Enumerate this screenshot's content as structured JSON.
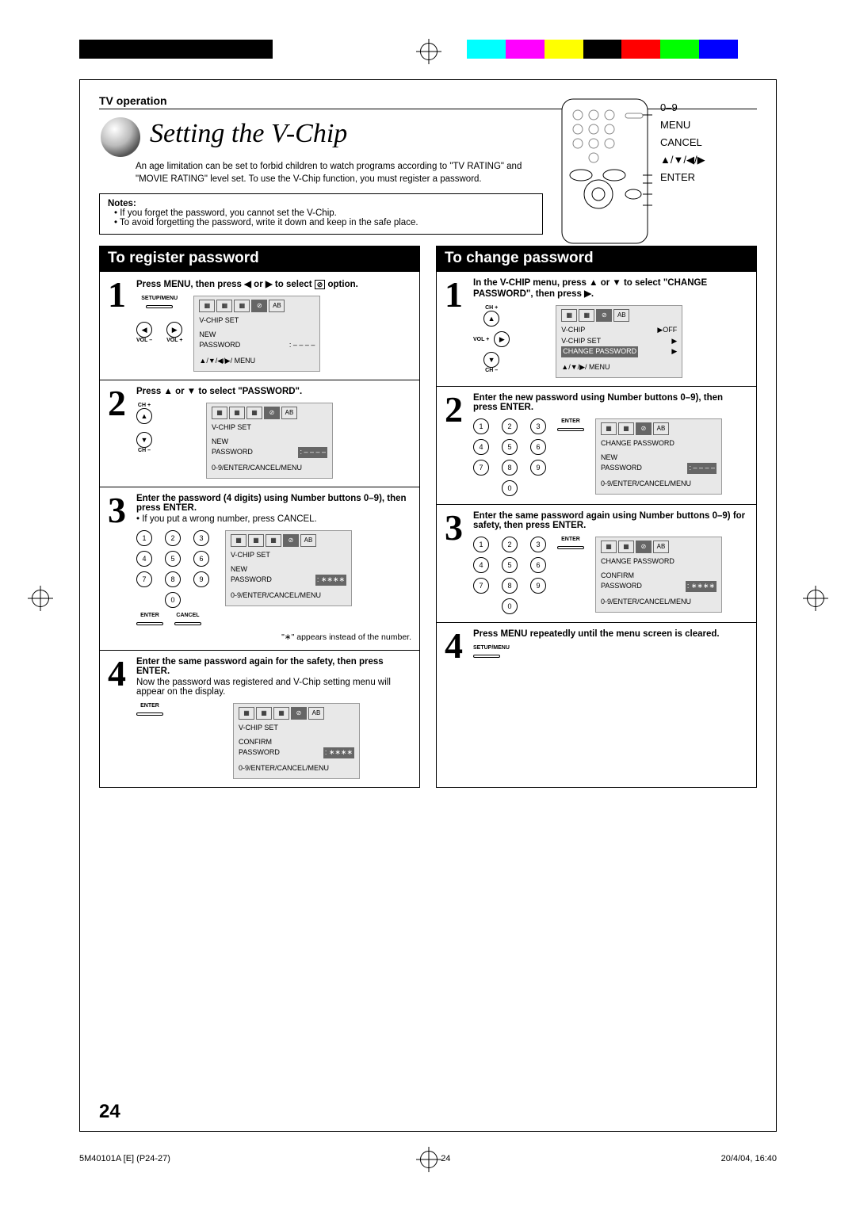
{
  "header": {
    "section": "TV operation"
  },
  "title": "Setting the V-Chip",
  "intro": "An age limitation can be set to forbid children to watch programs according to \"TV RATING\" and \"MOVIE RATING\" level set. To use the V-Chip function, you must register a password.",
  "notes": {
    "heading": "Notes:",
    "items": [
      "If you forget the password, you cannot set the V-Chip.",
      "To avoid forgetting the password, write it down and keep in the safe place."
    ]
  },
  "remote_labels": {
    "l1": "0–9",
    "l2": "MENU",
    "l3": "CANCEL",
    "l4": "▲/▼/◀/▶",
    "l5": "ENTER"
  },
  "left": {
    "heading": "To register password",
    "s1": {
      "text_a": "Press MENU, then press ◀ or ▶ to select ",
      "text_b": " option.",
      "btn_menu": "SETUP/MENU",
      "btn_voln": "VOL –",
      "btn_volp": "VOL +",
      "osd": {
        "title": "V-CHIP SET",
        "r1a": "NEW",
        "r1b": "",
        "r2a": "PASSWORD",
        "r2b": ": – – – –",
        "foot": "▲/▼/◀/▶/ MENU"
      }
    },
    "s2": {
      "text": "Press ▲ or ▼ to select \"PASSWORD\".",
      "btn_chp": "CH +",
      "btn_chn": "CH –",
      "osd": {
        "title": "V-CHIP SET",
        "r1a": "NEW",
        "r2a": "PASSWORD",
        "r2b": ": – – – –",
        "foot": "0-9/ENTER/CANCEL/MENU"
      }
    },
    "s3": {
      "text": "Enter the password (4 digits) using Number buttons 0–9), then press ENTER.",
      "sub": "If you put a wrong number, press CANCEL.",
      "btn_enter": "ENTER",
      "btn_cancel": "CANCEL",
      "osd": {
        "title": "V-CHIP SET",
        "r1a": "NEW",
        "r2a": "PASSWORD",
        "r2b": ": ∗∗∗∗",
        "foot": "0-9/ENTER/CANCEL/MENU"
      },
      "note": "\"∗\" appears instead of the number."
    },
    "s4": {
      "text": "Enter the same password again for the safety, then press ENTER.",
      "sub": "Now the password was registered and V-Chip setting menu will appear on the display.",
      "btn_enter": "ENTER",
      "osd": {
        "title": "V-CHIP SET",
        "r1a": "CONFIRM",
        "r2a": "PASSWORD",
        "r2b": ": ∗∗∗∗",
        "foot": "0-9/ENTER/CANCEL/MENU"
      }
    }
  },
  "right": {
    "heading": "To change password",
    "s1": {
      "text": "In the V-CHIP menu, press ▲ or ▼ to select \"CHANGE PASSWORD\", then press ▶.",
      "btn_chp": "CH +",
      "btn_volp": "VOL +",
      "btn_chn": "CH –",
      "osd": {
        "r1a": "V-CHIP",
        "r1b": "▶OFF",
        "r2a": "V-CHIP SET",
        "r2b": "▶",
        "r3a": "CHANGE PASSWORD",
        "r3b": "▶",
        "foot": "▲/▼/▶/ MENU"
      }
    },
    "s2": {
      "text": "Enter the new password using Number buttons 0–9), then press ENTER.",
      "btn_enter": "ENTER",
      "osd": {
        "title": "CHANGE  PASSWORD",
        "r1a": "NEW",
        "r2a": "PASSWORD",
        "r2b": ": – – – –",
        "foot": "0-9/ENTER/CANCEL/MENU"
      }
    },
    "s3": {
      "text": "Enter the same password again using Number buttons 0–9) for safety, then press ENTER.",
      "btn_enter": "ENTER",
      "osd": {
        "title": "CHANGE  PASSWORD",
        "r1a": "CONFIRM",
        "r2a": "PASSWORD",
        "r2b": ": ∗∗∗∗",
        "foot": "0-9/ENTER/CANCEL/MENU"
      }
    },
    "s4": {
      "text": "Press MENU repeatedly until the menu screen is cleared.",
      "btn_menu": "SETUP/MENU"
    }
  },
  "keypad": {
    "k1": "1",
    "k2": "2",
    "k3": "3",
    "k4": "4",
    "k5": "5",
    "k6": "6",
    "k7": "7",
    "k8": "8",
    "k9": "9",
    "k0": "0"
  },
  "page_number": "24",
  "footer": {
    "left": "5M40101A [E] (P24-27)",
    "mid": "24",
    "right": "20/4/04, 16:40"
  }
}
